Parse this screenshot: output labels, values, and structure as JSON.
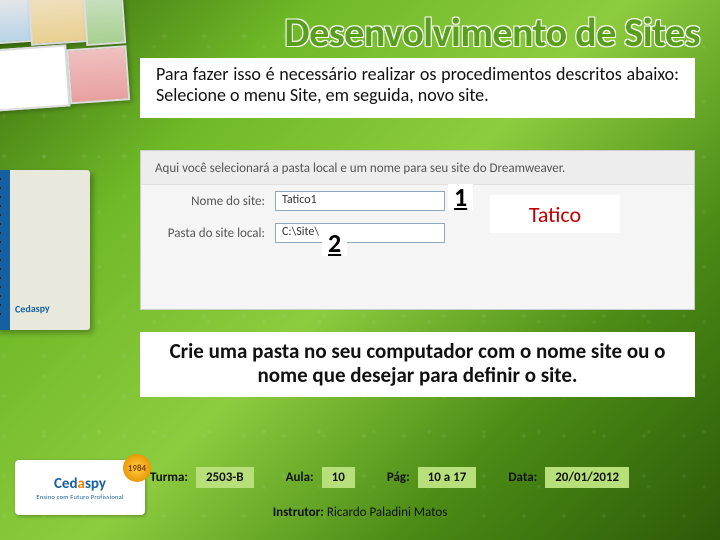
{
  "title": "Desenvolvimento de Sites",
  "instruction_top": "Para fazer isso é necessário realizar os procedimentos descritos abaixo: Selecione o menu Site, em seguida, novo site.",
  "dw": {
    "header": "Aqui você selecionará a pasta local e um nome para seu site do Dreamweaver.",
    "row1_label": "Nome do site:",
    "row1_value": "Tatico1",
    "row2_label": "Pasta do site local:",
    "row2_value": "C:\\Site\\"
  },
  "markers": {
    "one": "1",
    "two": "2"
  },
  "callout": "Tatico",
  "instruction_bottom": "Crie uma pasta no seu computador com o nome site ou o nome que desejar para definir o site.",
  "meta": {
    "turma_label": "Turma:",
    "turma_value": "2503-B",
    "aula_label": "Aula:",
    "aula_value": "10",
    "pag_label": "Pág:",
    "pag_value": "10 a 17",
    "data_label": "Data:",
    "data_value": "20/01/2012"
  },
  "logo": {
    "brand_pref": "Ced",
    "brand_mid": "a",
    "brand_suf": "spy",
    "tagline": "Ensino com Futuro Profissional",
    "badge": "1984"
  },
  "instructor_label": "Instrutor:",
  "instructor_name": "Ricardo Paladini Matos"
}
